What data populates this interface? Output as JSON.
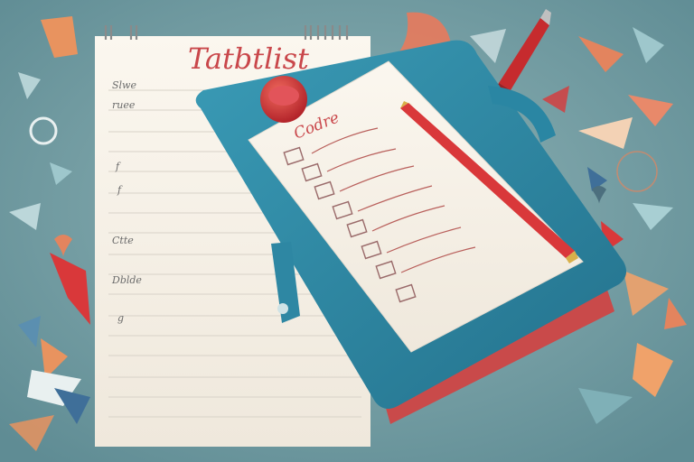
{
  "notepad": {
    "title": "Tatbtlist",
    "line_labels": [
      "Slwe",
      "ruee",
      "f",
      "f",
      "Ctte",
      "Dblde",
      "g"
    ]
  },
  "checklist": {
    "title": "Codre"
  },
  "colors": {
    "background": "#6f9aa1",
    "paper": "#f6f1e8",
    "folder_teal": "#2f8aa6",
    "accent_red": "#d9383a",
    "book_spine": "#c94a4a",
    "title_red": "#c9474b"
  }
}
